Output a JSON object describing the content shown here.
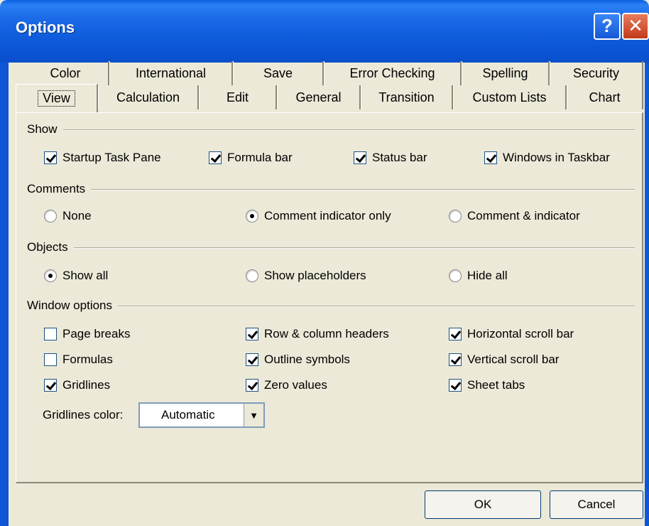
{
  "window": {
    "title": "Options",
    "help_glyph": "?",
    "close_glyph": "✕"
  },
  "tabs_row1": [
    "Color",
    "International",
    "Save",
    "Error Checking",
    "Spelling",
    "Security"
  ],
  "tabs_row2": [
    "View",
    "Calculation",
    "Edit",
    "General",
    "Transition",
    "Custom Lists",
    "Chart"
  ],
  "active_tab": "View",
  "show": {
    "label": "Show",
    "items": [
      {
        "label": "Startup Task Pane",
        "checked": true
      },
      {
        "label": "Formula bar",
        "checked": true
      },
      {
        "label": "Status bar",
        "checked": true
      },
      {
        "label": "Windows in Taskbar",
        "checked": true
      }
    ]
  },
  "comments": {
    "label": "Comments",
    "options": [
      {
        "label": "None",
        "selected": false
      },
      {
        "label": "Comment indicator only",
        "selected": true
      },
      {
        "label": "Comment & indicator",
        "selected": false
      }
    ]
  },
  "objects": {
    "label": "Objects",
    "options": [
      {
        "label": "Show all",
        "selected": true
      },
      {
        "label": "Show placeholders",
        "selected": false
      },
      {
        "label": "Hide all",
        "selected": false
      }
    ]
  },
  "window_options": {
    "label": "Window options",
    "items": [
      {
        "label": "Page breaks",
        "checked": false
      },
      {
        "label": "Row & column headers",
        "checked": true
      },
      {
        "label": "Horizontal scroll bar",
        "checked": true
      },
      {
        "label": "Formulas",
        "checked": false
      },
      {
        "label": "Outline symbols",
        "checked": true
      },
      {
        "label": "Vertical scroll bar",
        "checked": true
      },
      {
        "label": "Gridlines",
        "checked": true
      },
      {
        "label": "Zero values",
        "checked": true
      },
      {
        "label": "Sheet tabs",
        "checked": true
      }
    ],
    "gridlines_color_label": "Gridlines color:",
    "gridlines_color_value": "Automatic",
    "dropdown_glyph": "▼"
  },
  "buttons": {
    "ok": "OK",
    "cancel": "Cancel"
  }
}
